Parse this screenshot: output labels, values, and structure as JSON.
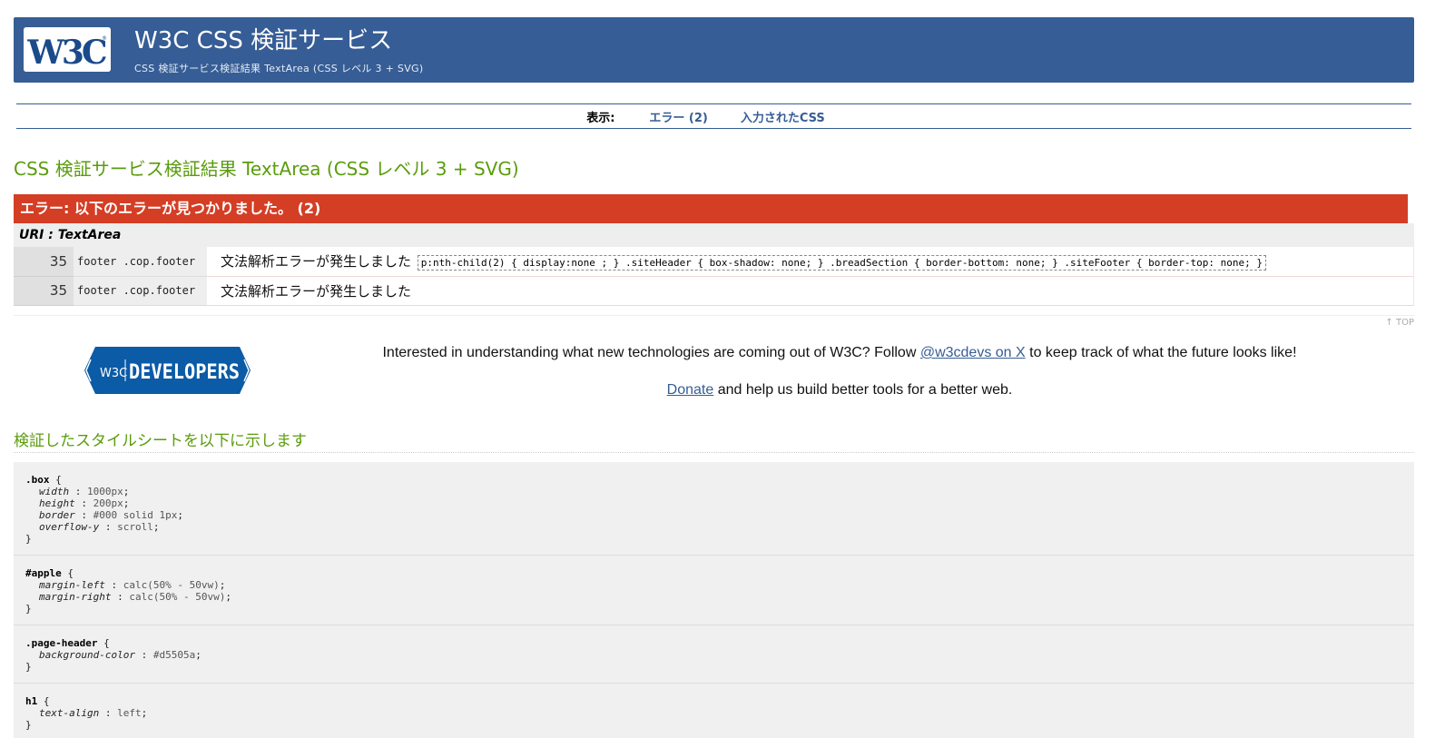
{
  "banner": {
    "logo_text": "W3C",
    "title": "W3C CSS 検証サービス",
    "subtitle": "CSS 検証サービス検証結果 TextArea (CSS レベル 3 + SVG)"
  },
  "nav": {
    "label": "表示:",
    "errors_link": "エラー (2)",
    "css_link": "入力されたCSS"
  },
  "page_title": "CSS 検証サービス検証結果 TextArea (CSS レベル 3 + SVG)",
  "errors": {
    "header": "エラー: 以下のエラーが見つかりました。 (2)",
    "uri": "URI : TextArea",
    "rows": [
      {
        "line": "35",
        "context": "footer .cop.footer",
        "message": "文法解析エラーが発生しました",
        "snippet": "p:nth-child(2) { display:none ; } .siteHeader { box-shadow: none; } .breadSection { border-bottom: none; } .siteFooter { border-top: none; }"
      },
      {
        "line": "35",
        "context": "footer .cop.footer",
        "message": "文法解析エラーが発生しました",
        "snippet": ""
      }
    ]
  },
  "top_link": "↑ TOP",
  "developers": {
    "logo_small": "W3C",
    "logo_text": "DEVELOPERS",
    "line1_pre": "Interested in understanding what new technologies are coming out of W3C? Follow ",
    "line1_link": "@w3cdevs on X",
    "line1_post": " to keep track of what the future looks like!",
    "line2_link": "Donate",
    "line2_post": " and help us build better tools for a better web."
  },
  "stylesheet": {
    "title": "検証したスタイルシートを以下に示します",
    "rules": [
      {
        "selector": ".box",
        "decls": [
          {
            "prop": "width",
            "value": "1000px"
          },
          {
            "prop": "height",
            "value": "200px"
          },
          {
            "prop": "border",
            "value": "#000 solid 1px"
          },
          {
            "prop": "overflow-y",
            "value": "scroll"
          }
        ]
      },
      {
        "selector": "#apple",
        "decls": [
          {
            "prop": "margin-left",
            "value": "calc(50% - 50vw)"
          },
          {
            "prop": "margin-right",
            "value": "calc(50% - 50vw)"
          }
        ]
      },
      {
        "selector": ".page-header",
        "decls": [
          {
            "prop": "background-color",
            "value": "#d5505a"
          }
        ]
      },
      {
        "selector": "h1",
        "decls": [
          {
            "prop": "text-align",
            "value": "left"
          }
        ]
      }
    ]
  },
  "colors": {
    "banner": "#365d95",
    "title_green": "#5a9c0c",
    "error_red": "#d43e25",
    "dev_blue": "#0b5ba6"
  }
}
